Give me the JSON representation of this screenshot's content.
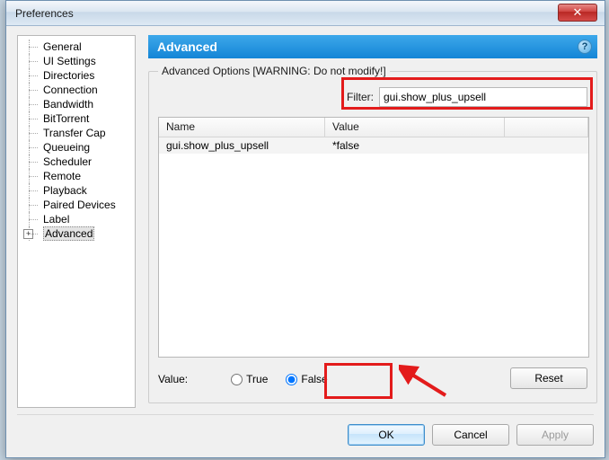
{
  "window": {
    "title": "Preferences",
    "close_symbol": "✕"
  },
  "tree": {
    "items": [
      {
        "label": "General"
      },
      {
        "label": "UI Settings"
      },
      {
        "label": "Directories"
      },
      {
        "label": "Connection"
      },
      {
        "label": "Bandwidth"
      },
      {
        "label": "BitTorrent"
      },
      {
        "label": "Transfer Cap"
      },
      {
        "label": "Queueing"
      },
      {
        "label": "Scheduler"
      },
      {
        "label": "Remote"
      },
      {
        "label": "Playback"
      },
      {
        "label": "Paired Devices"
      },
      {
        "label": "Label"
      },
      {
        "label": "Advanced",
        "expandable": true,
        "selected": true
      }
    ]
  },
  "section": {
    "title": "Advanced",
    "help_symbol": "?",
    "group_label": "Advanced Options [WARNING: Do not modify!]"
  },
  "filter": {
    "label": "Filter:",
    "value": "gui.show_plus_upsell"
  },
  "table": {
    "headers": {
      "name": "Name",
      "value": "Value"
    },
    "rows": [
      {
        "name": "gui.show_plus_upsell",
        "value": "*false"
      }
    ]
  },
  "value_editor": {
    "label": "Value:",
    "true_label": "True",
    "false_label": "False",
    "selected": "false",
    "reset_label": "Reset"
  },
  "buttons": {
    "ok": "OK",
    "cancel": "Cancel",
    "apply": "Apply"
  }
}
